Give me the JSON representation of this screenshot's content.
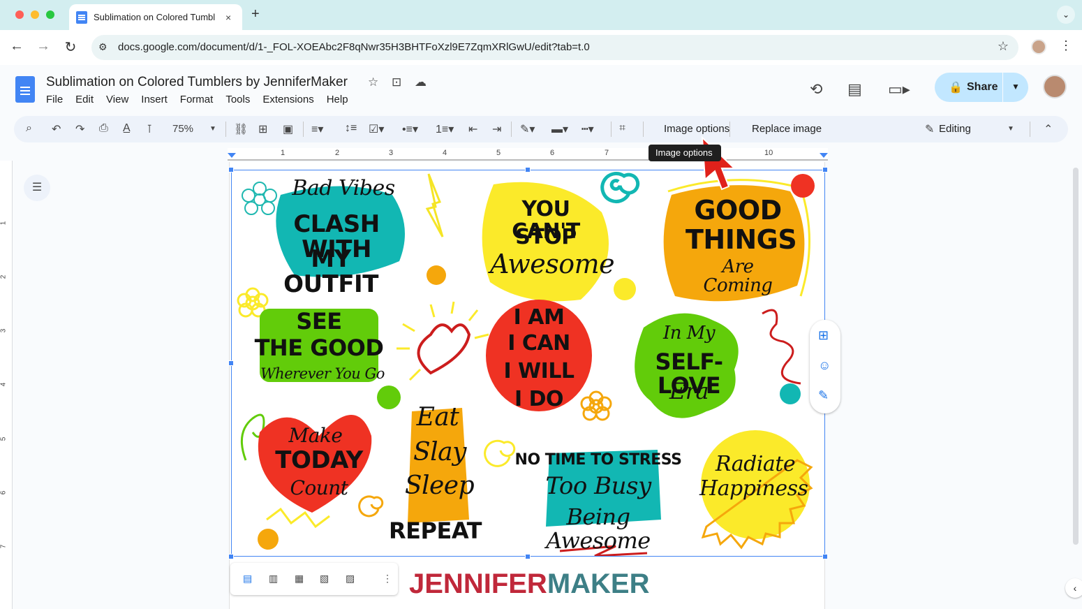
{
  "browser": {
    "tab_title": "Sublimation on Colored Tumbl",
    "tab_close": "×",
    "new_tab": "+",
    "url": "docs.google.com/document/d/1-_FOL-XOEAbc2F8qNwr35H3BHTFoXzl9E7ZqmXRlGwU/edit?tab=t.0",
    "back": "←",
    "forward": "→",
    "reload": "↻",
    "bookmark_icon": "☆",
    "menu_icon": "⋮",
    "tab_menu": "⌄"
  },
  "docs": {
    "title": "Sublimation on Colored Tumblers by JenniferMaker",
    "menu": [
      "File",
      "Edit",
      "View",
      "Insert",
      "Format",
      "Tools",
      "Extensions",
      "Help"
    ],
    "share_label": "Share",
    "editing_label": "Editing",
    "zoom": "75%",
    "image_options": "Image options",
    "replace_image": "Replace image",
    "tooltip": "Image options"
  },
  "ruler": {
    "h": [
      "1",
      "2",
      "3",
      "4",
      "5",
      "6",
      "7",
      "10"
    ],
    "v": [
      "1",
      "2",
      "3",
      "4",
      "5",
      "6",
      "7"
    ]
  },
  "stickers": {
    "s1": [
      "Bad Vibes",
      "CLASH WITH",
      "MY OUTFIT"
    ],
    "s2": [
      "YOU CAN'T",
      "STOP",
      "Awesome"
    ],
    "s3": [
      "GOOD",
      "THINGS",
      "Are Coming"
    ],
    "s4": [
      "SEE",
      "THE GOOD",
      "Wherever You Go"
    ],
    "s5": [
      "I AM",
      "I CAN",
      "I WILL",
      "I DO"
    ],
    "s6": [
      "In My",
      "SELF-LOVE",
      "Era"
    ],
    "s7": [
      "Make",
      "TODAY",
      "Count"
    ],
    "s8": [
      "Eat",
      "Slay",
      "Sleep",
      "REPEAT"
    ],
    "s9": [
      "NO TIME TO STRESS",
      "Too Busy",
      "Being Awesome"
    ],
    "s10": [
      "Radiate",
      "Happiness"
    ]
  },
  "brand": {
    "part1": "JENNIFER",
    "part2": "MAKER",
    "color1": "#c0283a",
    "color2": "#3d7f86"
  },
  "colors": {
    "accent": "#4285f4",
    "share_bg": "#c2e7ff",
    "toolbar_bg": "#edf2fa"
  }
}
